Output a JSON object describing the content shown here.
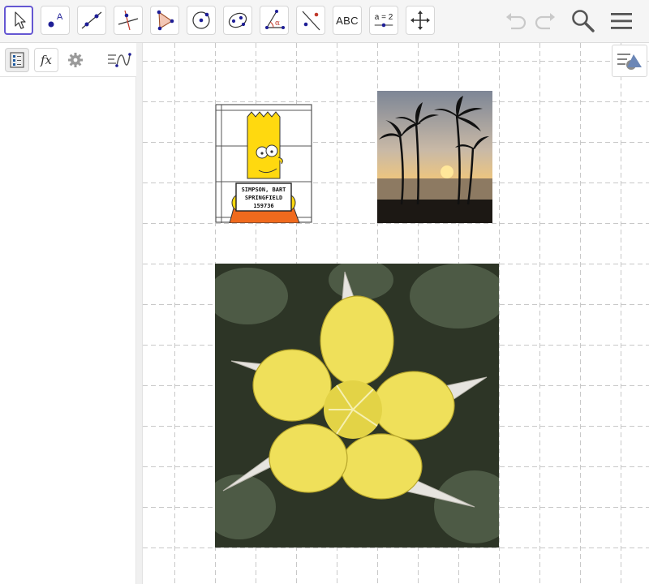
{
  "toolbar": {
    "tools": [
      {
        "name": "move-tool",
        "icon": "arrow-pointer-icon",
        "active": true
      },
      {
        "name": "point-tool",
        "icon": "point-icon",
        "label": "A"
      },
      {
        "name": "line-tool",
        "icon": "line-icon"
      },
      {
        "name": "perpendicular-tool",
        "icon": "perpendicular-icon"
      },
      {
        "name": "polygon-tool",
        "icon": "polygon-icon"
      },
      {
        "name": "circle-tool",
        "icon": "circle-icon"
      },
      {
        "name": "ellipse-tool",
        "icon": "ellipse-icon"
      },
      {
        "name": "angle-tool",
        "icon": "angle-icon",
        "label": "α"
      },
      {
        "name": "reflect-tool",
        "icon": "reflect-icon"
      },
      {
        "name": "text-tool",
        "icon": "text-icon",
        "label": "ABC"
      },
      {
        "name": "slider-tool",
        "icon": "slider-icon",
        "label": "a = 2"
      },
      {
        "name": "move-graphics-tool",
        "icon": "move-arrows-icon"
      }
    ],
    "right": [
      {
        "name": "undo",
        "icon": "undo-icon"
      },
      {
        "name": "redo",
        "icon": "redo-icon"
      },
      {
        "name": "search",
        "icon": "search-icon"
      },
      {
        "name": "menu",
        "icon": "hamburger-menu-icon"
      }
    ]
  },
  "algebra": {
    "buttons": [
      {
        "name": "algebra-view",
        "icon": "algebra-tree-icon"
      },
      {
        "name": "input-bar",
        "icon": "fx-icon",
        "label": "fx"
      },
      {
        "name": "settings",
        "icon": "gear-icon"
      },
      {
        "name": "graph-view",
        "icon": "graphics-view-icon"
      }
    ]
  },
  "graphics": {
    "style_bar_icon": "style-bar-toggle-icon",
    "images": [
      {
        "name": "bart-simpson-image",
        "caption_lines": [
          "SIMPSON, BART",
          "SPRINGFIELD",
          "159736"
        ]
      },
      {
        "name": "palm-trees-sunset-image"
      },
      {
        "name": "yellow-columbine-flower-image"
      }
    ]
  },
  "colors": {
    "accent": "#6557d2",
    "point": "#1e1e96",
    "grid": "#c8c8c8"
  }
}
